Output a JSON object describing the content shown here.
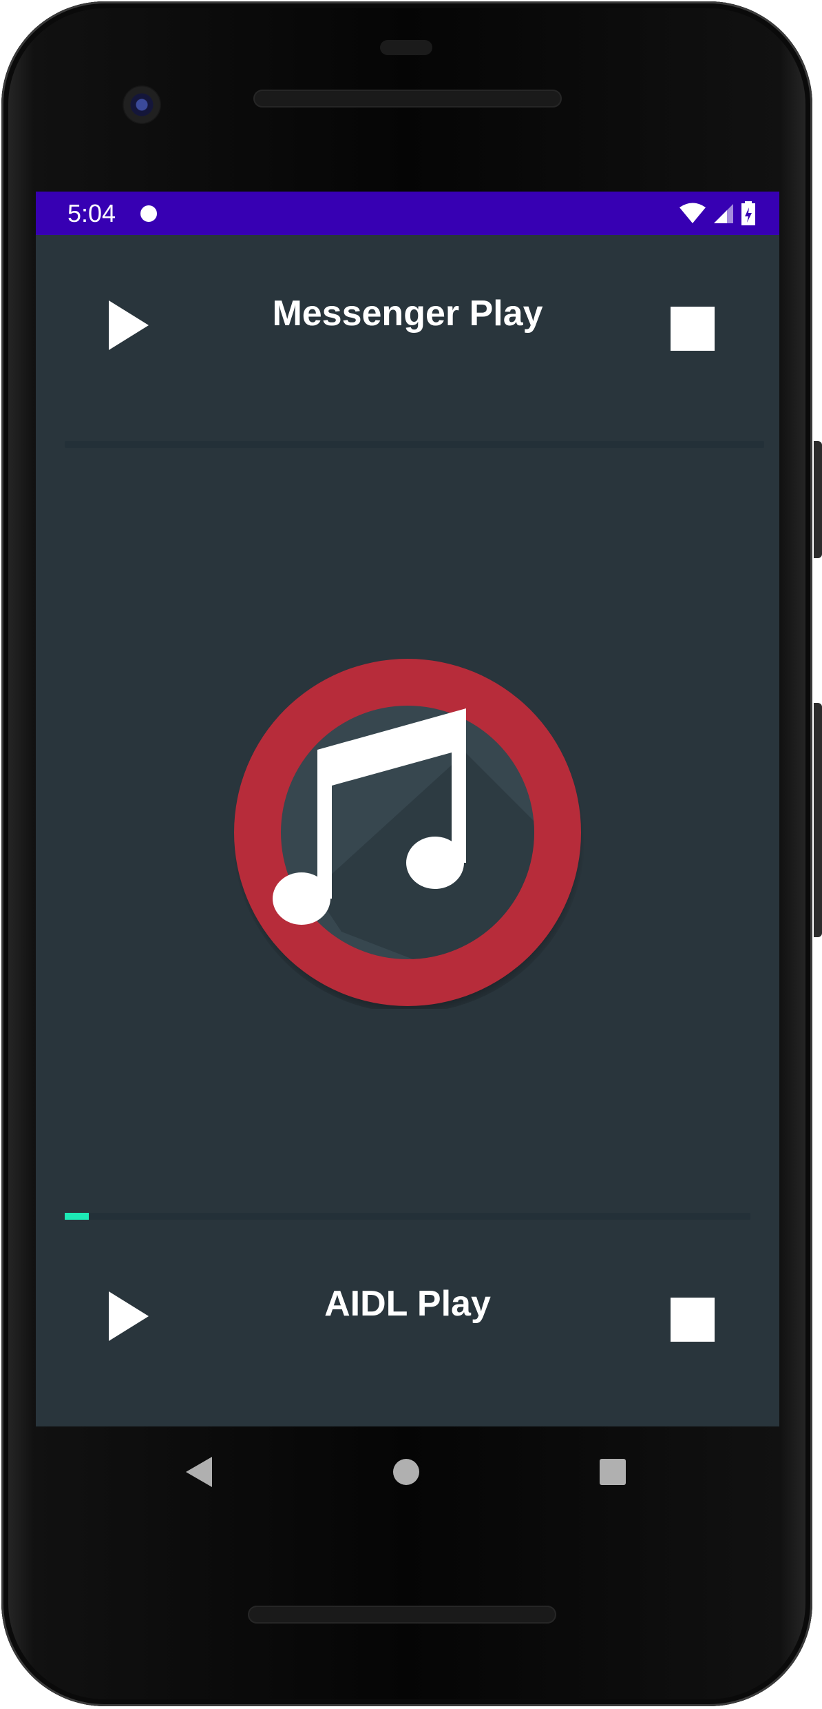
{
  "status_bar": {
    "time": "5:04",
    "background": "#3700b3",
    "icons": [
      "notification-dot-icon",
      "wifi-icon",
      "signal-icon",
      "battery-charging-icon"
    ]
  },
  "messenger_player": {
    "title": "Messenger Play",
    "play_icon": "play-icon",
    "stop_icon": "stop-icon",
    "progress": 0
  },
  "album_art": {
    "icon": "music-note-icon",
    "ring_color": "#b72c3a",
    "inner_color": "#37474f"
  },
  "aidl_player": {
    "title": "AIDL Play",
    "play_icon": "play-icon",
    "stop_icon": "stop-icon",
    "progress": 0.035,
    "progress_color": "#1de9b6"
  },
  "nav_bar": {
    "buttons": [
      "back-icon",
      "home-icon",
      "recents-icon"
    ]
  },
  "colors": {
    "screen_background": "#29353c",
    "track": "#233038"
  }
}
